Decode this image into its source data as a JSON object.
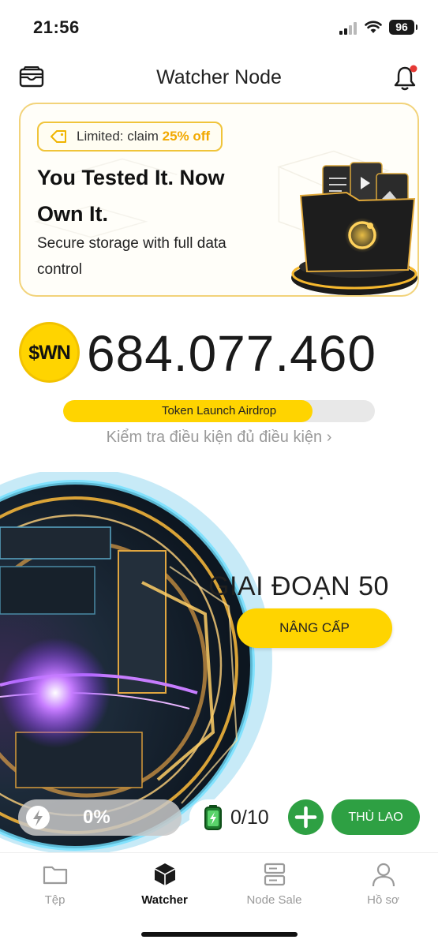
{
  "status_bar": {
    "time": "21:56",
    "battery": "96"
  },
  "header": {
    "title": "Watcher Node"
  },
  "promo": {
    "tag_prefix": "Limited: claim ",
    "tag_highlight": "25% off",
    "title": "You Tested It. Now Own It.",
    "subtitle": "Secure storage with full data control"
  },
  "balance": {
    "token_logo": "$WN",
    "value": "684.077.460"
  },
  "airdrop": {
    "label": "Token Launch Airdrop",
    "progress_fraction": 0.8
  },
  "eligibility_link": "Kiểm tra điều kiện đủ điều kiện  ›",
  "stage": {
    "title": "GIAI ĐOẠN 50",
    "upgrade_label": "NÂNG CẤP"
  },
  "stats": {
    "energy_value": "0%",
    "battery_count": "0/10",
    "reward_label": "THÙ LAO"
  },
  "tabs": [
    {
      "label": "Tệp",
      "icon": "folder-icon",
      "active": false
    },
    {
      "label": "Watcher",
      "icon": "cube-icon",
      "active": true
    },
    {
      "label": "Node Sale",
      "icon": "server-icon",
      "active": false
    },
    {
      "label": "Hồ sơ",
      "icon": "user-icon",
      "active": false
    }
  ],
  "colors": {
    "accent": "#ffd400",
    "green": "#2ea043",
    "promo_border": "#f2d37a"
  }
}
